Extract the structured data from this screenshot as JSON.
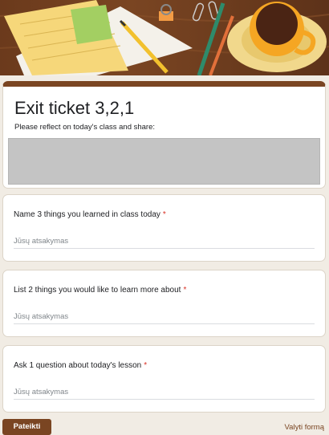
{
  "form": {
    "title": "Exit ticket 3,2,1",
    "description": "Please reflect on today's class and share:",
    "accent_color": "#7a4522",
    "required_marker": "*"
  },
  "questions": [
    {
      "label": "Name 3 things you learned in class today",
      "placeholder": "Jūsų atsakymas"
    },
    {
      "label": "List 2 things you would like to learn more about",
      "placeholder": "Jūsų atsakymas"
    },
    {
      "label": "Ask 1 question about today's lesson",
      "placeholder": "Jūsų atsakymas"
    }
  ],
  "footer": {
    "submit_label": "Pateikti",
    "clear_label": "Valyti formą"
  },
  "icons": [
    "banner-illustration"
  ]
}
